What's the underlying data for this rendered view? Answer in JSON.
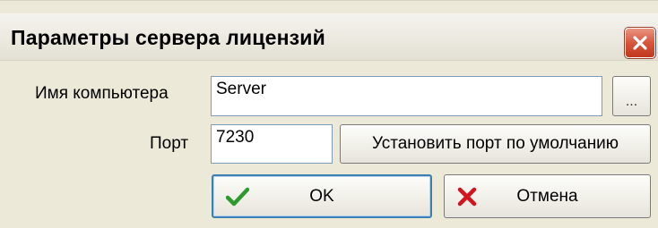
{
  "window": {
    "title": "Параметры сервера лицензий"
  },
  "form": {
    "computer_name_label": "Имя компьютера",
    "computer_name_value": "Server",
    "browse_label": "...",
    "port_label": "Порт",
    "port_value": "7230",
    "default_port_label": "Установить порт по умолчанию"
  },
  "actions": {
    "ok_label": "OK",
    "cancel_label": "Отмена"
  },
  "colors": {
    "ok_check": "#2e9a2e",
    "cancel_cross": "#d4141c",
    "close_button": "#d7553c"
  },
  "icons": {
    "close": "close-icon",
    "ok": "check-icon",
    "cancel": "cross-icon"
  }
}
